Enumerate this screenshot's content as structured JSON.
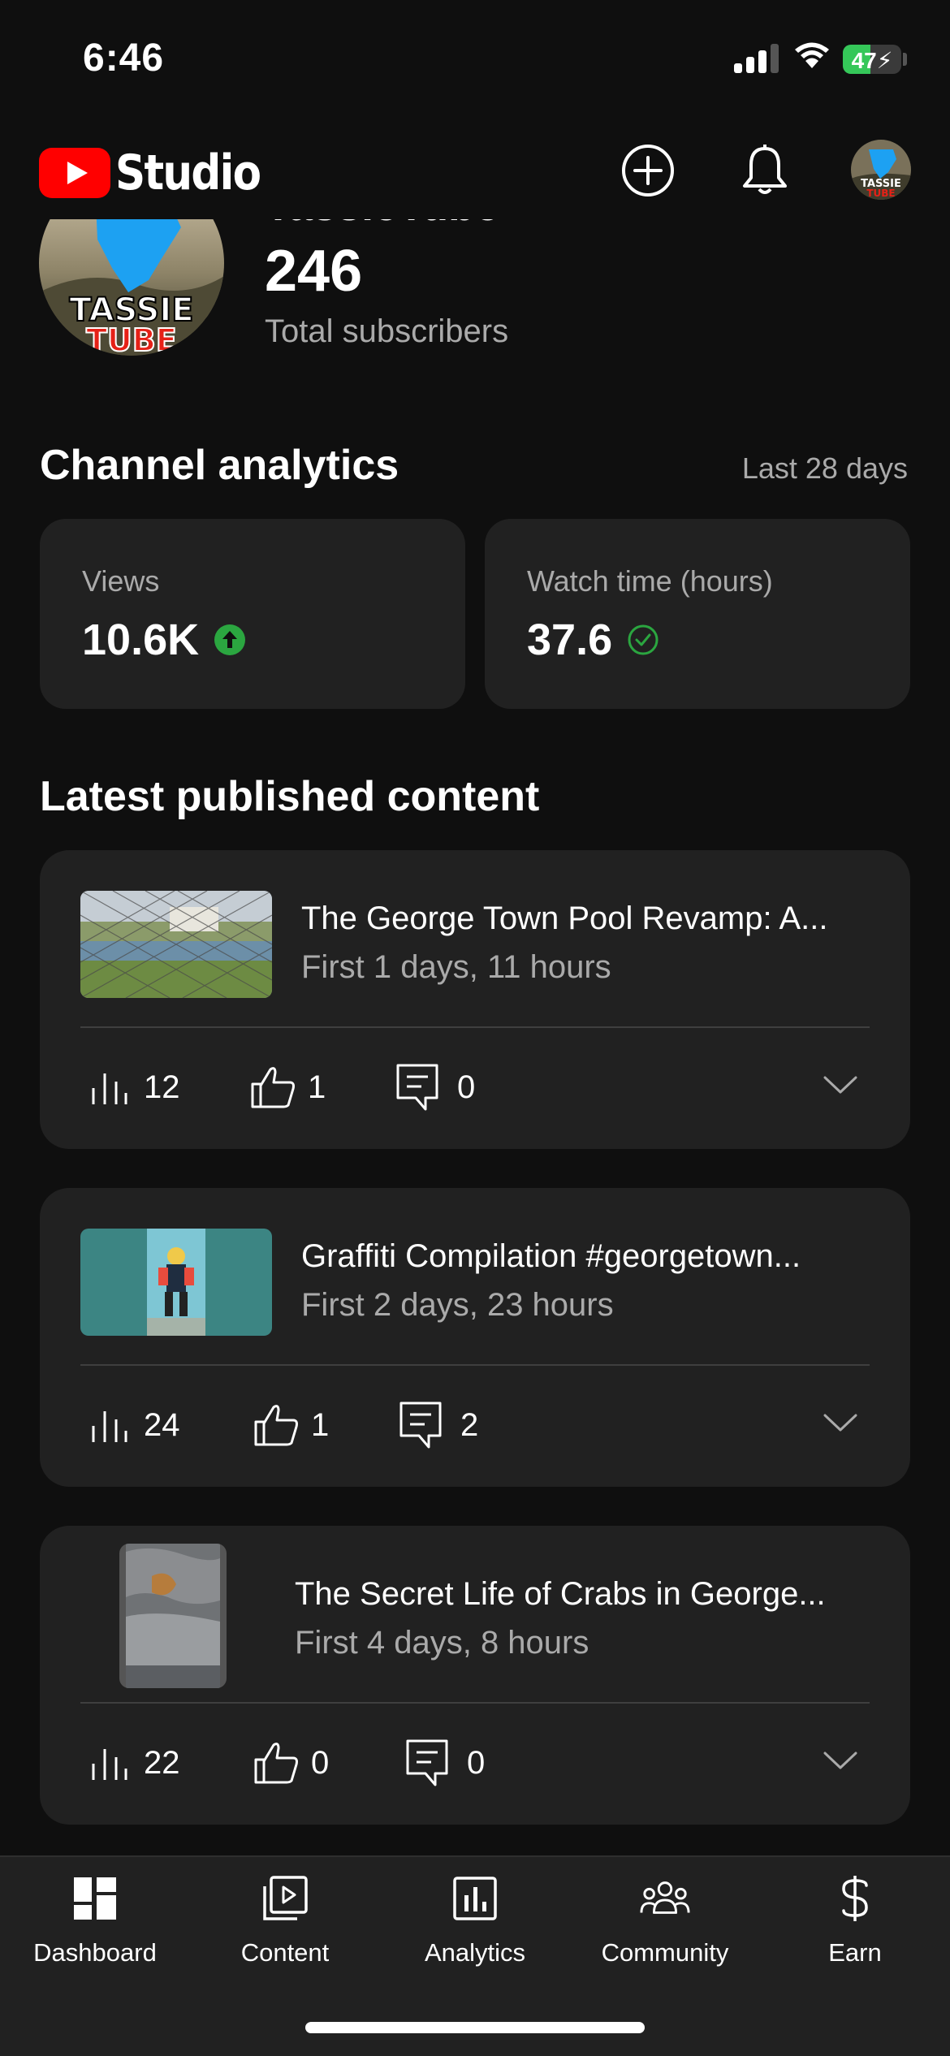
{
  "status_bar": {
    "time": "6:46",
    "battery": "47",
    "battery_level": 0.47,
    "signal_bars": 3
  },
  "header": {
    "logo_text": "Studio",
    "create_icon": "plus-circle-icon",
    "notifications_icon": "bell-icon"
  },
  "channel": {
    "name": "TassieTube",
    "avatar_text": [
      "TASSIE",
      "TUBE"
    ],
    "subscribers": "246",
    "subscribers_label": "Total subscribers"
  },
  "analytics": {
    "title": "Channel analytics",
    "range": "Last 28 days",
    "cards": [
      {
        "label": "Views",
        "value": "10.6K",
        "badge": "arrow-up-circle-icon"
      },
      {
        "label": "Watch time (hours)",
        "value": "37.6",
        "badge": "check-circle-icon"
      }
    ]
  },
  "latest": {
    "title": "Latest published content",
    "items": [
      {
        "title": "The George Town Pool Revamp: A...",
        "subtitle": "First 1 days, 11 hours",
        "views": "12",
        "likes": "1",
        "comments": "0"
      },
      {
        "title": "Graffiti Compilation #georgetown...",
        "subtitle": "First 2 days, 23 hours",
        "views": "24",
        "likes": "1",
        "comments": "2"
      },
      {
        "title": "The Secret Life of Crabs in George...",
        "subtitle": "First 4 days, 8 hours",
        "views": "22",
        "likes": "0",
        "comments": "0"
      }
    ]
  },
  "nav": [
    {
      "label": "Dashboard",
      "icon": "dashboard-icon"
    },
    {
      "label": "Content",
      "icon": "content-icon"
    },
    {
      "label": "Analytics",
      "icon": "analytics-icon"
    },
    {
      "label": "Community",
      "icon": "community-icon"
    },
    {
      "label": "Earn",
      "icon": "dollar-icon"
    }
  ],
  "colors": {
    "background": "#0f0f0f",
    "card": "#212121",
    "accent_red": "#ff0000",
    "success_green": "#2ba640",
    "secondary_text": "#aaaaaa"
  }
}
